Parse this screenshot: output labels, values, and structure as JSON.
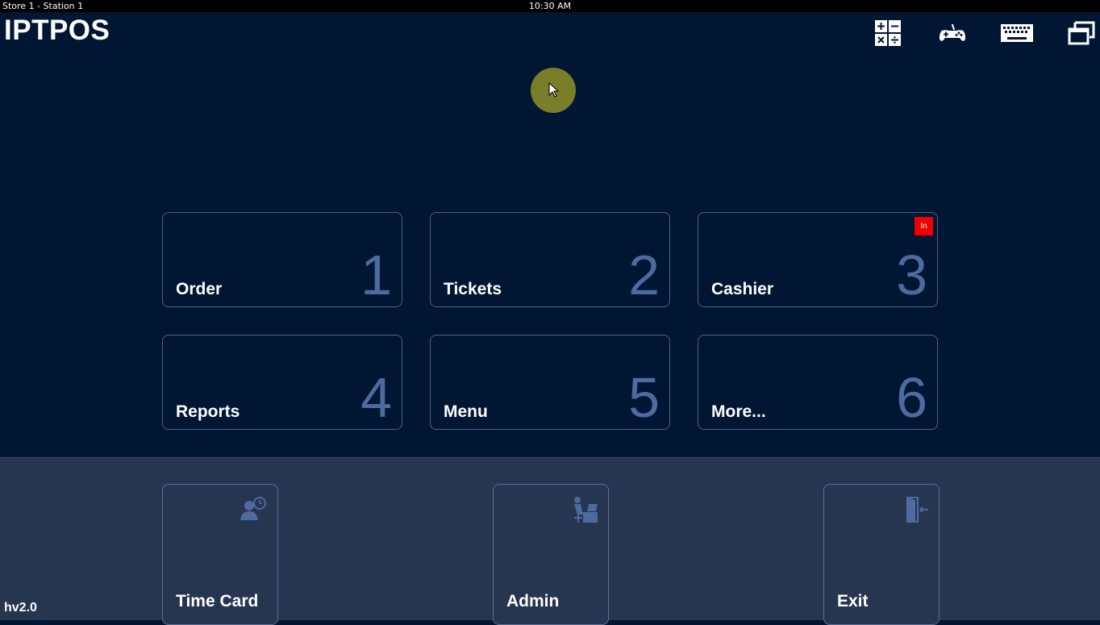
{
  "window": {
    "title": "Store 1 - Station 1",
    "clock": "10:30 AM"
  },
  "header": {
    "logo": "IPTPOS",
    "tools": [
      {
        "icon": "calculator-icon"
      },
      {
        "icon": "gamepad-icon"
      },
      {
        "icon": "keyboard-icon"
      },
      {
        "icon": "restore-window-icon"
      }
    ]
  },
  "tiles": [
    {
      "label": "Order",
      "number": "1"
    },
    {
      "label": "Tickets",
      "number": "2"
    },
    {
      "label": "Cashier",
      "number": "3",
      "badge": "In"
    },
    {
      "label": "Reports",
      "number": "4"
    },
    {
      "label": "Menu",
      "number": "5"
    },
    {
      "label": "More...",
      "number": "6"
    }
  ],
  "footer": {
    "buttons": [
      {
        "label": "Time Card",
        "icon": "time-card-icon"
      },
      {
        "label": "Admin",
        "icon": "admin-desk-icon"
      },
      {
        "label": "Exit",
        "icon": "exit-door-icon"
      }
    ],
    "version": "hv2.0"
  },
  "colors": {
    "background": "#011632",
    "footer": "#263550",
    "tile_border": "#4d6189",
    "tile_number": "#4e6b9f",
    "badge": "#ee0000"
  }
}
